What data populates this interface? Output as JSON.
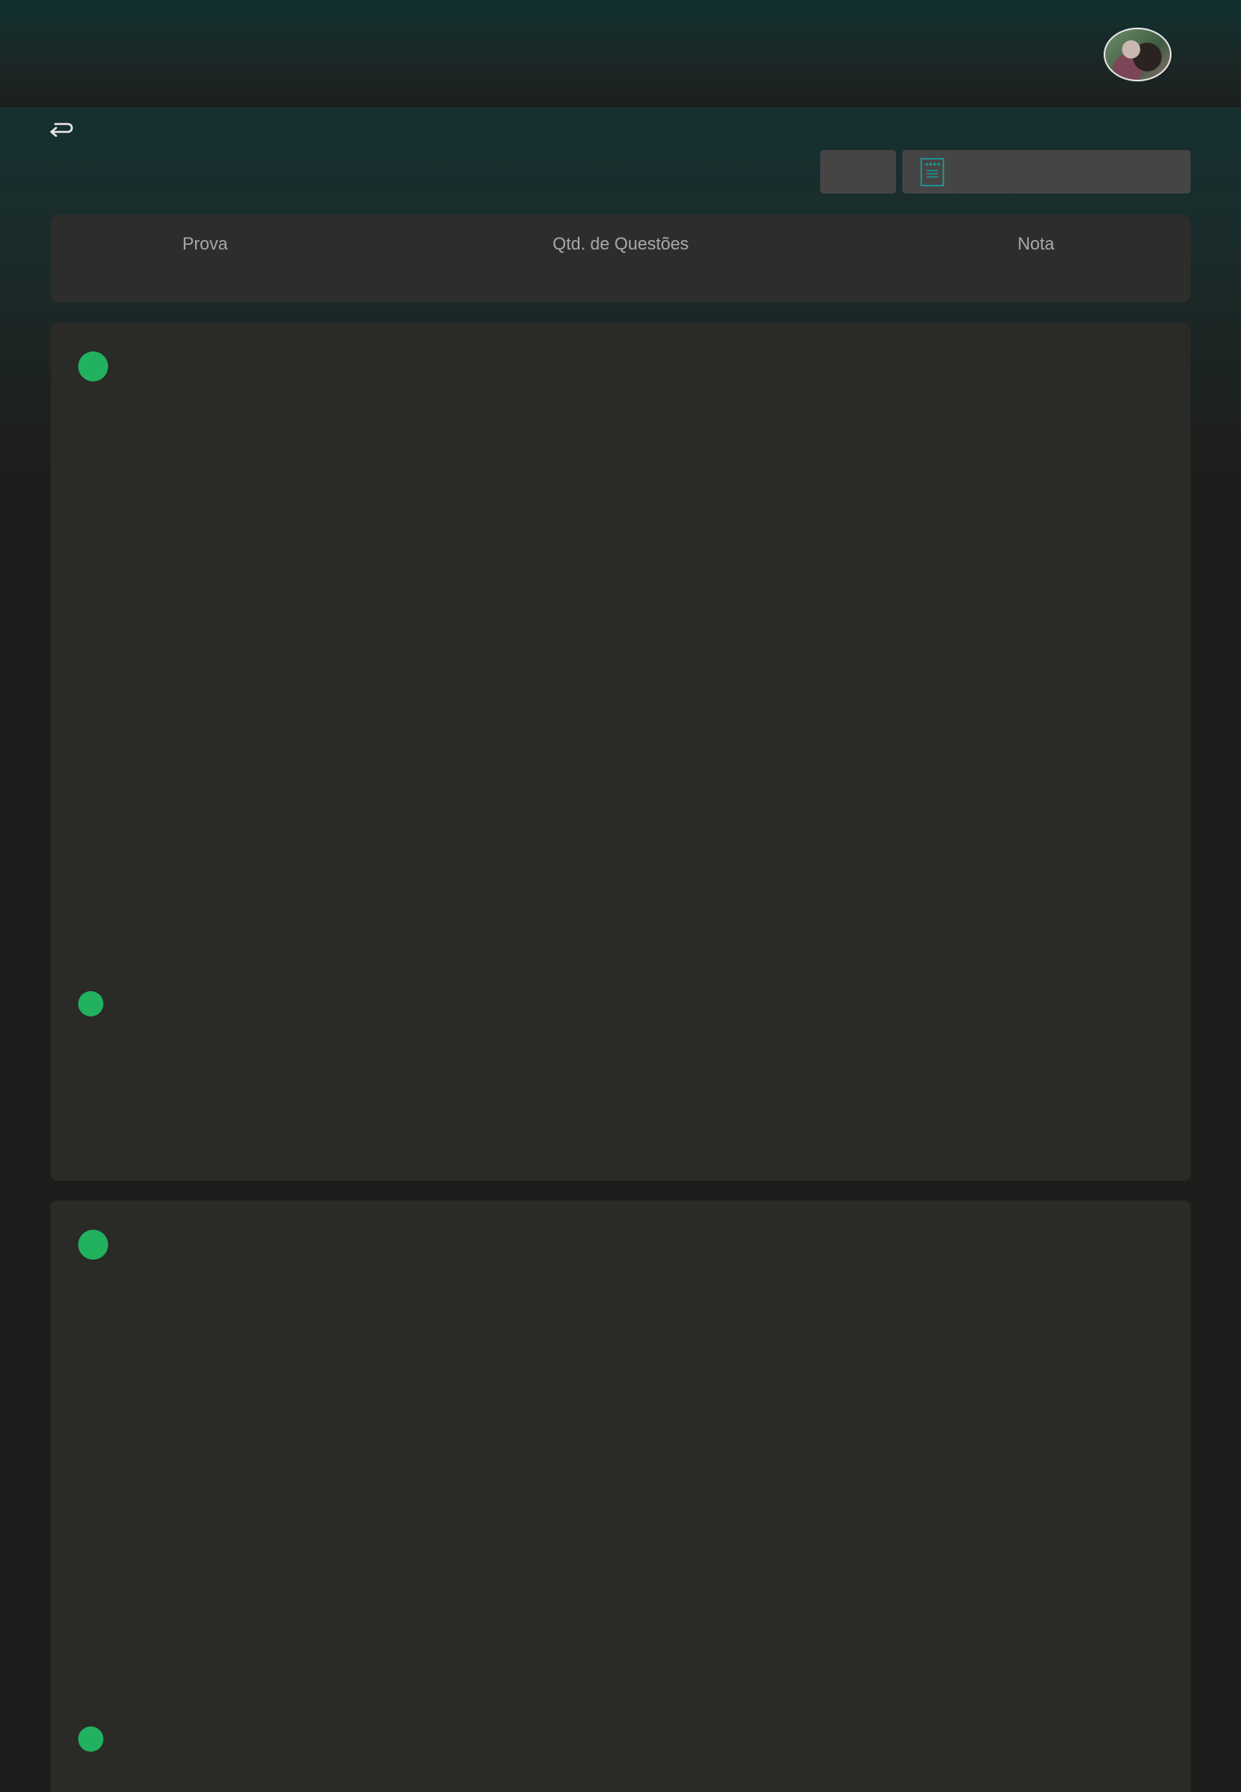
{
  "header": {
    "avatar_icon": "user-avatar-photo"
  },
  "toolbar": {
    "back_icon": "return-arrow-icon",
    "select_icon": "document-list-icon",
    "select_value": "",
    "button_label": ""
  },
  "table": {
    "columns": [
      "Prova",
      "Qtd. de Questões",
      "Nota"
    ]
  },
  "colors": {
    "accent_green": "#22b15f",
    "teal_icon": "#14a39a",
    "card_bg": "#2a2a27",
    "header_bg": "#123535"
  }
}
